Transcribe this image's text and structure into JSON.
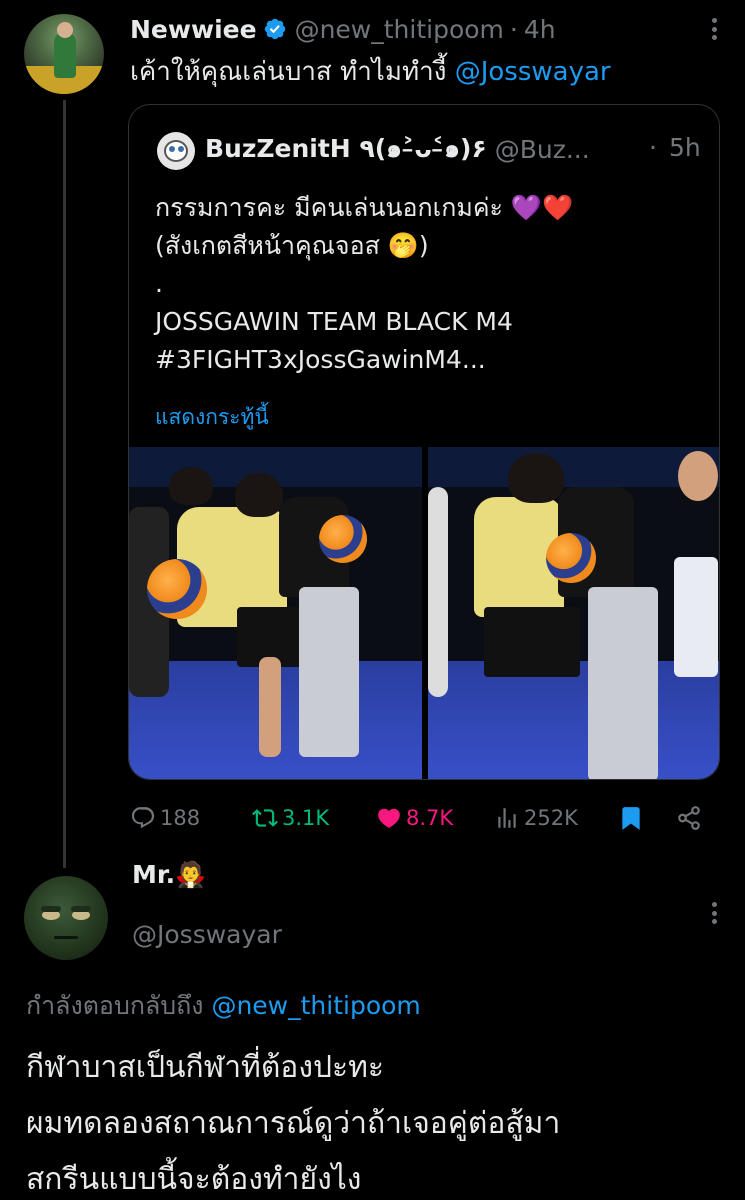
{
  "tweet": {
    "author_name": "Newwiee",
    "author_handle": "@new_thitipoom",
    "separator": "·",
    "time": "4h",
    "text": "เค้าให้คุณเล่นบาส ทำไมทำงี้ ",
    "mention": "@Josswayar",
    "quote": {
      "author_name": "BuzZenitH ٩(๑˃̵ᴗ˂̵๑)۶",
      "author_handle": "@Buz...",
      "separator": "·",
      "time": "5h",
      "lines": [
        "กรรมการคะ มีคนเล่นนอกเกมค่ะ 💜❤️",
        "(สังเกตสีหน้าคุณจอส 🤭)",
        ".",
        "JOSSGAWIN TEAM BLACK M4",
        "#3FIGHT3xJossGawinM4..."
      ],
      "show_more": "แสดงกระทู้นี้"
    },
    "stats": {
      "replies": "188",
      "retweets": "3.1K",
      "likes": "8.7K",
      "views": "252K"
    },
    "icons": [
      "reply-icon",
      "retweet-icon",
      "heart-icon",
      "views-icon",
      "bookmark-icon",
      "share-icon"
    ],
    "colors": {
      "retweet": "#00ba7c",
      "like": "#f91880",
      "bookmark": "#1d9bf0",
      "link": "#1d9bf0",
      "muted": "#71767b"
    }
  },
  "reply": {
    "author_name": "Mr.🧛",
    "author_handle": "@Josswayar",
    "replying_to_label": "กำลังตอบกลับถึง ",
    "replying_to_handle": "@new_thitipoom",
    "lines": [
      "กีฬาบาสเป็นกีฬาที่ต้องปะทะ",
      "ผมทดลองสถาณการณ์ดูว่าถ้าเจอคู่ต่อสู้มา",
      "สกรีนแบบนี้จะต้องทำยังไง"
    ]
  }
}
